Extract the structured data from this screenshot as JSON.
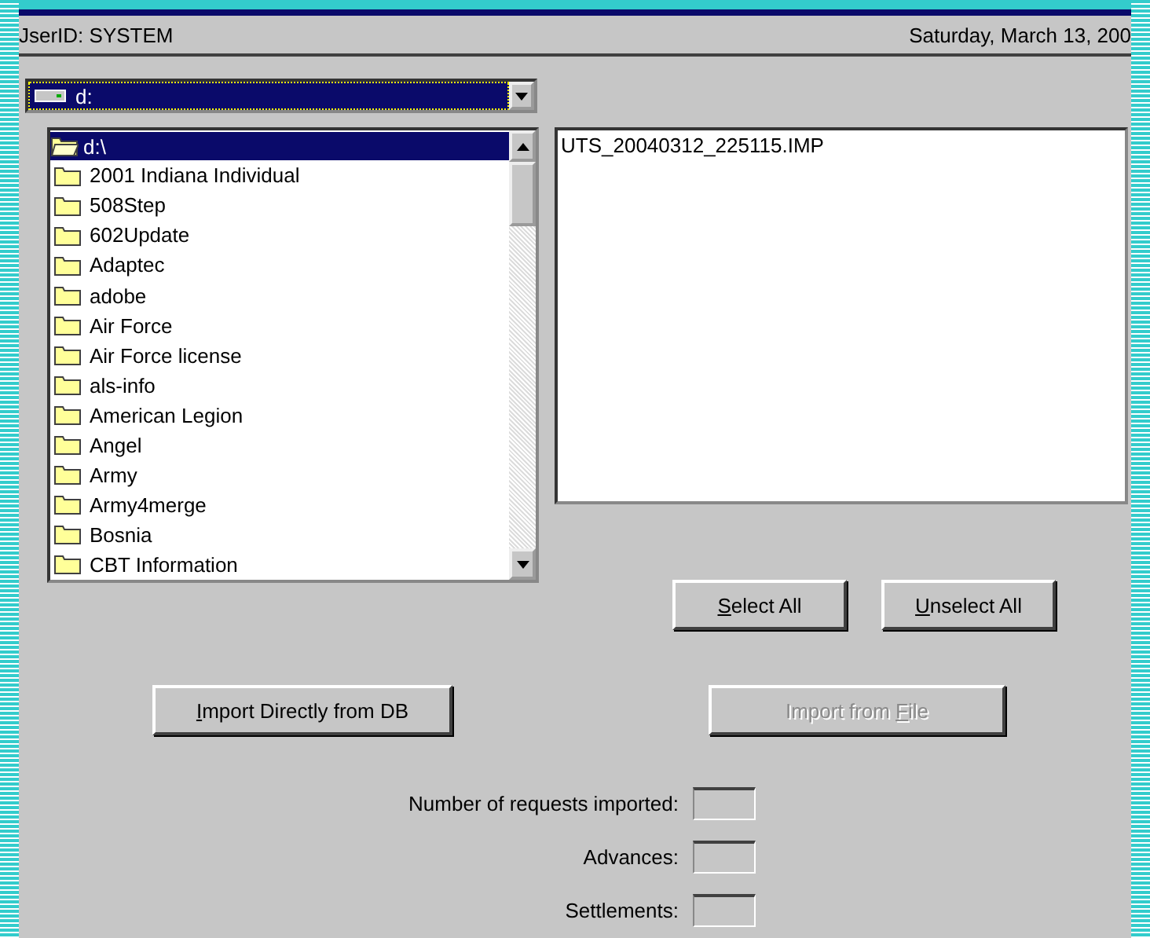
{
  "header": {
    "user": "JserID: SYSTEM",
    "date": "Saturday, March 13, 200"
  },
  "drive": {
    "label": "d:",
    "selected": true
  },
  "folders": [
    {
      "name": "d:\\",
      "selected": true,
      "open": true
    },
    {
      "name": "2001 Indiana Individual",
      "selected": false,
      "open": false
    },
    {
      "name": "508Step",
      "selected": false,
      "open": false
    },
    {
      "name": "602Update",
      "selected": false,
      "open": false
    },
    {
      "name": "Adaptec",
      "selected": false,
      "open": false
    },
    {
      "name": "adobe",
      "selected": false,
      "open": false
    },
    {
      "name": "Air Force",
      "selected": false,
      "open": false
    },
    {
      "name": "Air Force license",
      "selected": false,
      "open": false
    },
    {
      "name": "als-info",
      "selected": false,
      "open": false
    },
    {
      "name": "American Legion",
      "selected": false,
      "open": false
    },
    {
      "name": "Angel",
      "selected": false,
      "open": false
    },
    {
      "name": "Army",
      "selected": false,
      "open": false
    },
    {
      "name": "Army4merge",
      "selected": false,
      "open": false
    },
    {
      "name": "Bosnia",
      "selected": false,
      "open": false
    },
    {
      "name": "CBT Information",
      "selected": false,
      "open": false
    }
  ],
  "files": [
    {
      "name": "UTS_20040312_225115.IMP",
      "selected": false
    }
  ],
  "list_buttons": [
    {
      "key": "S",
      "after": "elect All",
      "disabled": false
    },
    {
      "key": "U",
      "after": "nselect All",
      "disabled": false
    }
  ],
  "import_buttons": [
    {
      "key": "I",
      "after": "mport Directly from DB",
      "disabled": false
    },
    {
      "before": "Import from ",
      "key": "F",
      "after": "ile",
      "disabled": true
    }
  ],
  "counters": [
    {
      "label": "Number of requests imported:"
    },
    {
      "label": "Advances:"
    },
    {
      "label": "Settlements:"
    }
  ]
}
